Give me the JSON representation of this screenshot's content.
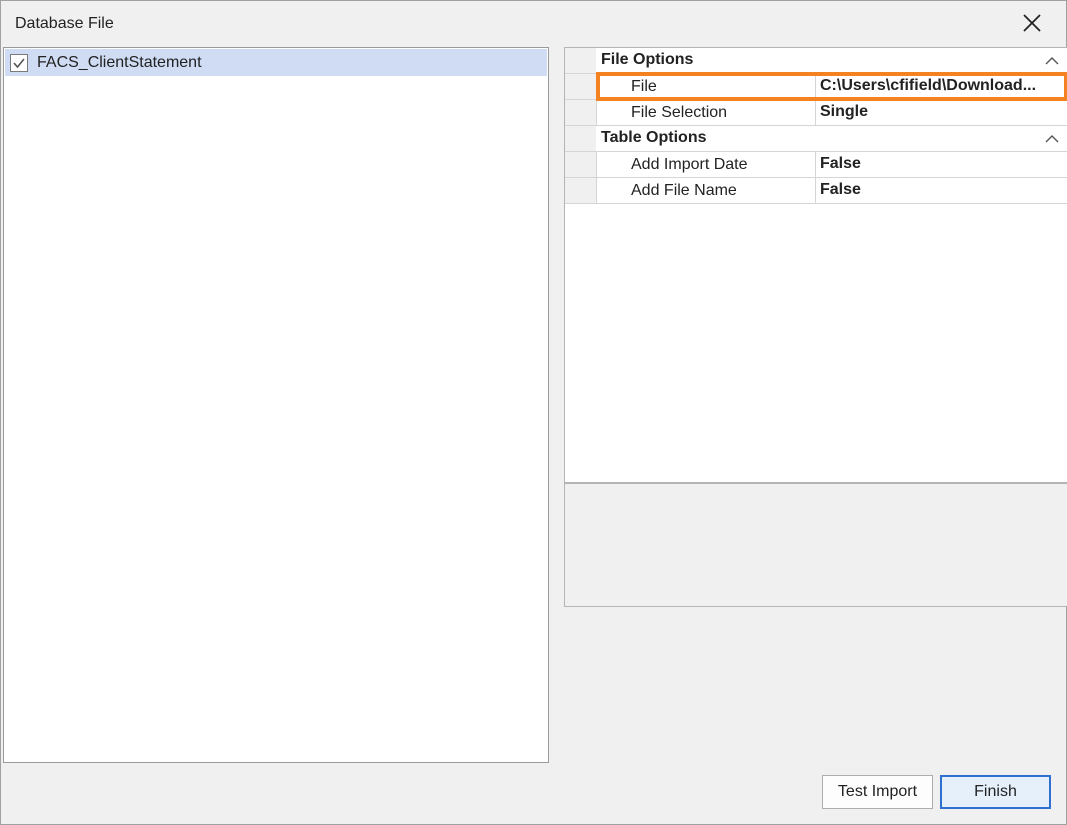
{
  "window": {
    "title": "Database File",
    "close_icon": "close-icon"
  },
  "tree": {
    "items": [
      {
        "label": "FACS_ClientStatement",
        "checked": true
      }
    ]
  },
  "property_grid": {
    "categories": [
      {
        "label": "File Options",
        "expanded": true,
        "properties": [
          {
            "name": "File",
            "value": "C:\\Users\\cfifield\\Download..."
          },
          {
            "name": "File Selection",
            "value": "Single"
          }
        ]
      },
      {
        "label": "Table Options",
        "expanded": true,
        "properties": [
          {
            "name": "Add Import Date",
            "value": "False"
          },
          {
            "name": "Add File Name",
            "value": "False"
          }
        ]
      }
    ],
    "highlight_color": "#f58220"
  },
  "buttons": {
    "test_import": "Test Import",
    "finish": "Finish"
  },
  "colors": {
    "selection": "#cfdcf3",
    "default_button_border": "#2f6fd1"
  }
}
